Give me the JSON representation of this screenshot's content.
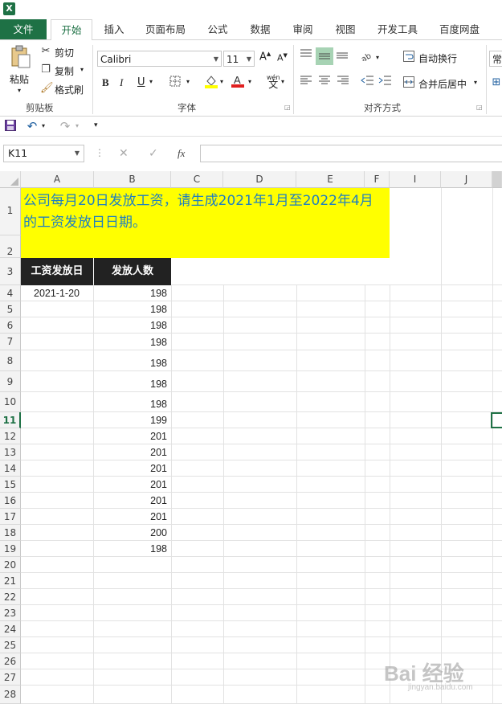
{
  "app": {
    "logo_text": "X",
    "brand_color": "#1e7145"
  },
  "tabs": [
    "文件",
    "开始",
    "插入",
    "页面布局",
    "公式",
    "数据",
    "审阅",
    "视图",
    "开发工具",
    "百度网盘"
  ],
  "clipboard": {
    "paste": "粘贴",
    "cut": "剪切",
    "copy": "复制",
    "format_painter": "格式刷",
    "group": "剪贴板"
  },
  "font": {
    "name": "Calibri",
    "size": "11",
    "bold": "B",
    "italic": "I",
    "underline": "U",
    "phonetic": "wén",
    "phonetic_char": "文",
    "group": "字体"
  },
  "alignment": {
    "wrap_text": "自动换行",
    "merge_center": "合并后居中",
    "group": "对齐方式"
  },
  "number": {
    "format": "常"
  },
  "formula_bar": {
    "name_box": "K11",
    "fx": "fx"
  },
  "columns": [
    "A",
    "B",
    "C",
    "D",
    "E",
    "F",
    "I",
    "J"
  ],
  "rows": [
    "1",
    "2",
    "3",
    "4",
    "5",
    "6",
    "7",
    "8",
    "9",
    "10",
    "11",
    "12",
    "13",
    "14",
    "15",
    "16",
    "17",
    "18",
    "19",
    "20",
    "21",
    "22",
    "23",
    "24",
    "25",
    "26",
    "27",
    "28"
  ],
  "banner": {
    "text": "公司每月20日发放工资，请生成2021年1月至2022年4月的工资发放日日期。",
    "bg": "#ffff00",
    "text_color": "#1f7fc1"
  },
  "table": {
    "headers": [
      "工资发放日",
      "发放人数"
    ],
    "first_date": "2021-1-20",
    "counts": [
      "198",
      "198",
      "198",
      "198",
      "198",
      "198",
      "198",
      "199",
      "201",
      "201",
      "201",
      "201",
      "201",
      "201",
      "200",
      "198"
    ]
  },
  "watermark": {
    "text": "Bai 经验",
    "sub": "jingyan.baidu.com"
  }
}
